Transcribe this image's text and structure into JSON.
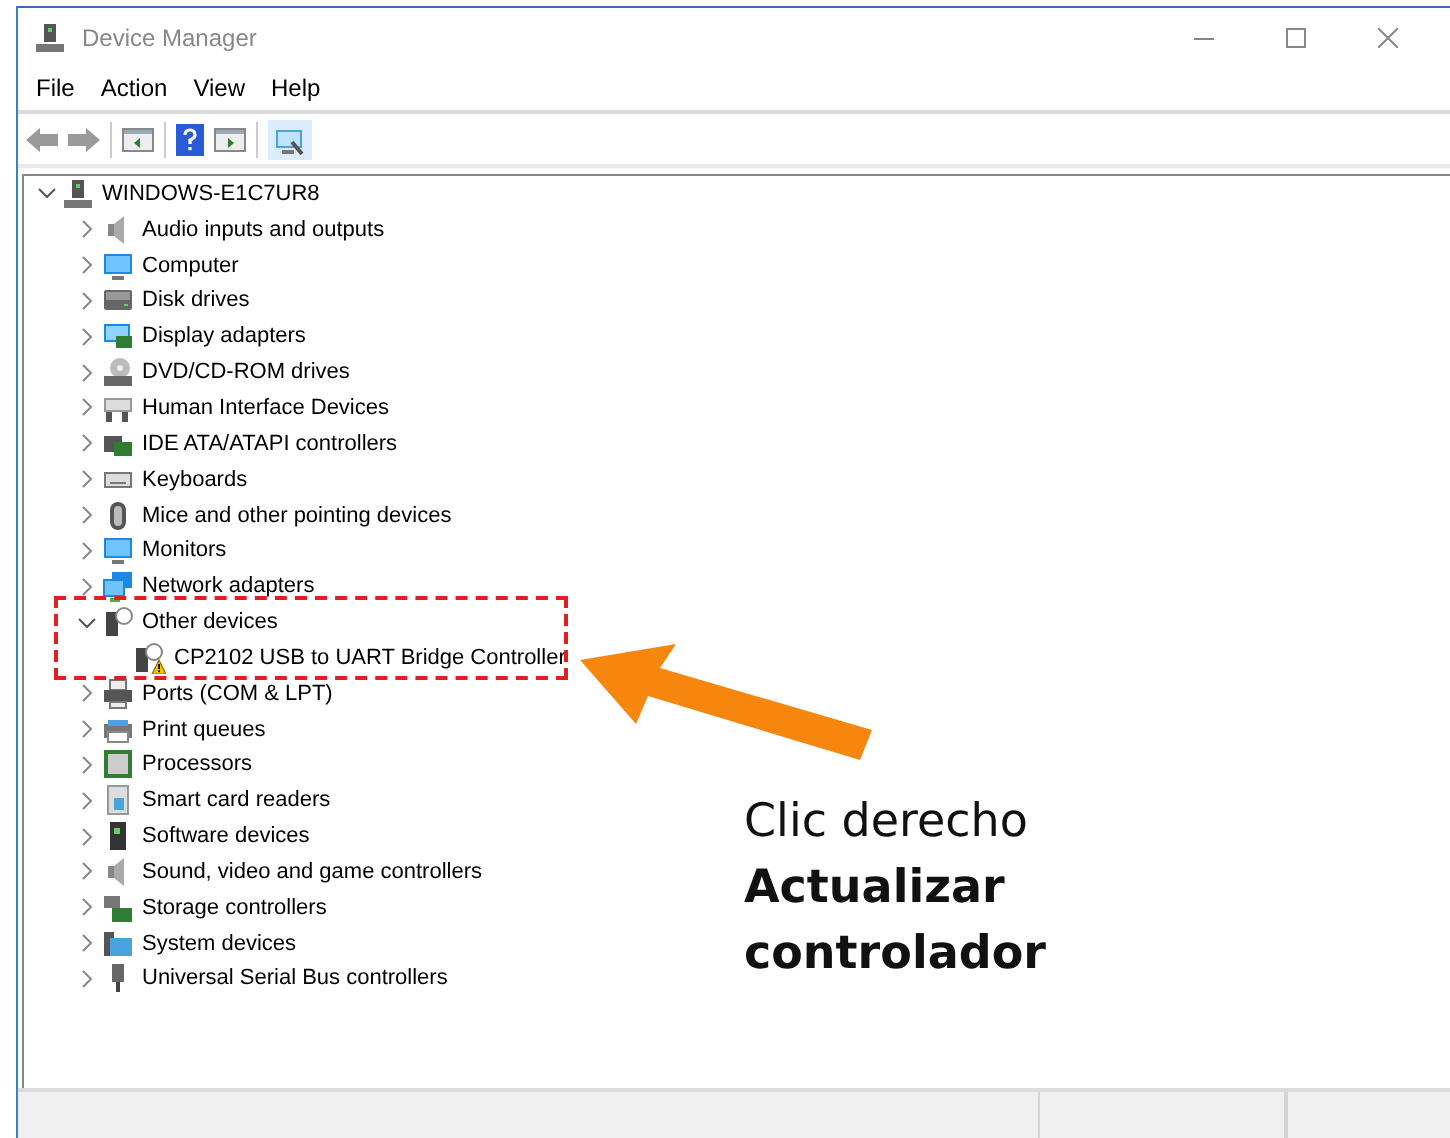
{
  "window": {
    "title": "Device Manager"
  },
  "menu": [
    "File",
    "Action",
    "View",
    "Help"
  ],
  "tree": {
    "label": "WINDOWS-E1C7UR8",
    "kind": "computer-root",
    "expanded": true,
    "children": [
      {
        "label": "Audio inputs and outputs",
        "kind": "audio",
        "expanded": false
      },
      {
        "label": "Computer",
        "kind": "computer",
        "expanded": false
      },
      {
        "label": "Disk drives",
        "kind": "disk",
        "expanded": false
      },
      {
        "label": "Display adapters",
        "kind": "display",
        "expanded": false
      },
      {
        "label": "DVD/CD-ROM drives",
        "kind": "dvd",
        "expanded": false
      },
      {
        "label": "Human Interface Devices",
        "kind": "hid",
        "expanded": false
      },
      {
        "label": "IDE ATA/ATAPI controllers",
        "kind": "ide",
        "expanded": false
      },
      {
        "label": "Keyboards",
        "kind": "keyboard",
        "expanded": false
      },
      {
        "label": "Mice and other pointing devices",
        "kind": "mouse",
        "expanded": false
      },
      {
        "label": "Monitors",
        "kind": "monitor",
        "expanded": false
      },
      {
        "label": "Network adapters",
        "kind": "network",
        "expanded": false
      },
      {
        "label": "Other devices",
        "kind": "other",
        "expanded": true,
        "children": [
          {
            "label": "CP2102 USB to UART Bridge Controller",
            "kind": "unknown-device",
            "warning": true
          }
        ]
      },
      {
        "label": "Ports (COM & LPT)",
        "kind": "ports",
        "expanded": false
      },
      {
        "label": "Print queues",
        "kind": "print",
        "expanded": false
      },
      {
        "label": "Processors",
        "kind": "processor",
        "expanded": false
      },
      {
        "label": "Smart card readers",
        "kind": "smartcard",
        "expanded": false
      },
      {
        "label": "Software devices",
        "kind": "software",
        "expanded": false
      },
      {
        "label": "Sound, video and game controllers",
        "kind": "audio",
        "expanded": false
      },
      {
        "label": "Storage controllers",
        "kind": "storage",
        "expanded": false
      },
      {
        "label": "System devices",
        "kind": "system",
        "expanded": false
      },
      {
        "label": "Universal Serial Bus controllers",
        "kind": "usb",
        "expanded": false
      }
    ]
  },
  "annotation": {
    "lines": [
      {
        "text": "Clic derecho",
        "bold": false
      },
      {
        "text": "Actualizar",
        "bold": true
      },
      {
        "text": "controlador",
        "bold": true
      }
    ]
  }
}
